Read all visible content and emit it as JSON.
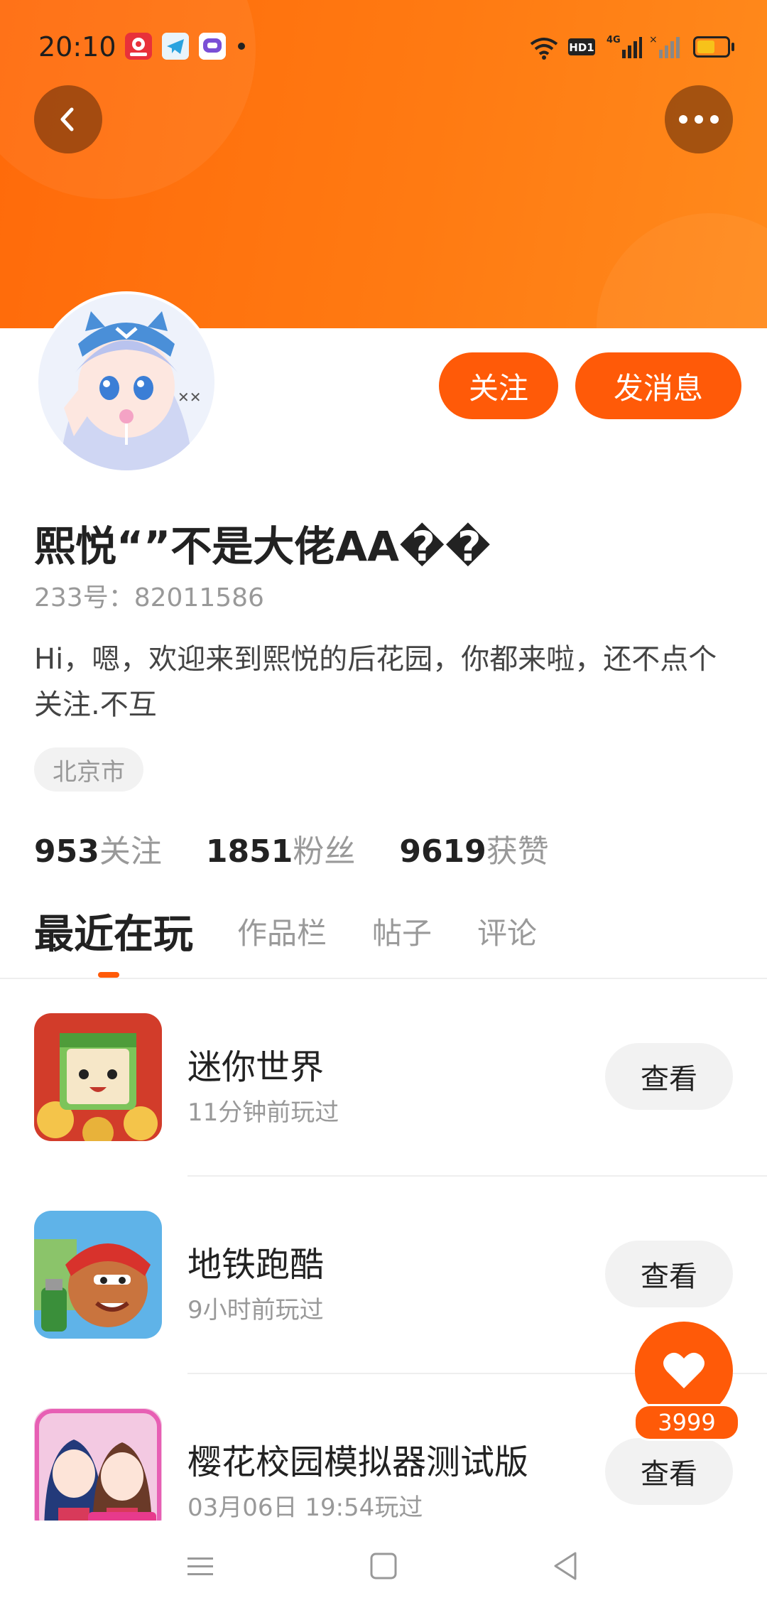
{
  "status_bar": {
    "time": "20:10",
    "network": "4G",
    "hd_label": "HD1",
    "battery_color": "#f7c21a"
  },
  "header": {
    "accent_color": "#ff6a0a",
    "back_icon": "chevron-left-icon",
    "more_icon": "more-dots-icon"
  },
  "profile": {
    "follow_label": "关注",
    "message_label": "发消息",
    "username": "熙悦“”不是大佬AA��",
    "user_id": "233号：82011586",
    "bio": "Hi，嗯，欢迎来到熙悦的后花园，你都来啦，还不点个关注.不互",
    "location": "北京市"
  },
  "stats": [
    {
      "value": "953",
      "label": "关注"
    },
    {
      "value": "1851",
      "label": "粉丝"
    },
    {
      "value": "9619",
      "label": "获赞"
    }
  ],
  "tabs": [
    "最近在玩",
    "作品栏",
    "帖子",
    "评论"
  ],
  "games": [
    {
      "name": "迷你世界",
      "played": "11分钟前玩过",
      "button": "查看"
    },
    {
      "name": "地铁跑酷",
      "played": "9小时前玩过",
      "button": "查看"
    },
    {
      "name": "樱花校园模拟器测试版",
      "played": "03月06日 19:54玩过",
      "button": "查看"
    }
  ],
  "like": {
    "icon": "heart-icon",
    "count": "3999"
  },
  "nav_bar": {
    "icons": [
      "menu-icon",
      "home-square-icon",
      "back-triangle-icon"
    ]
  }
}
